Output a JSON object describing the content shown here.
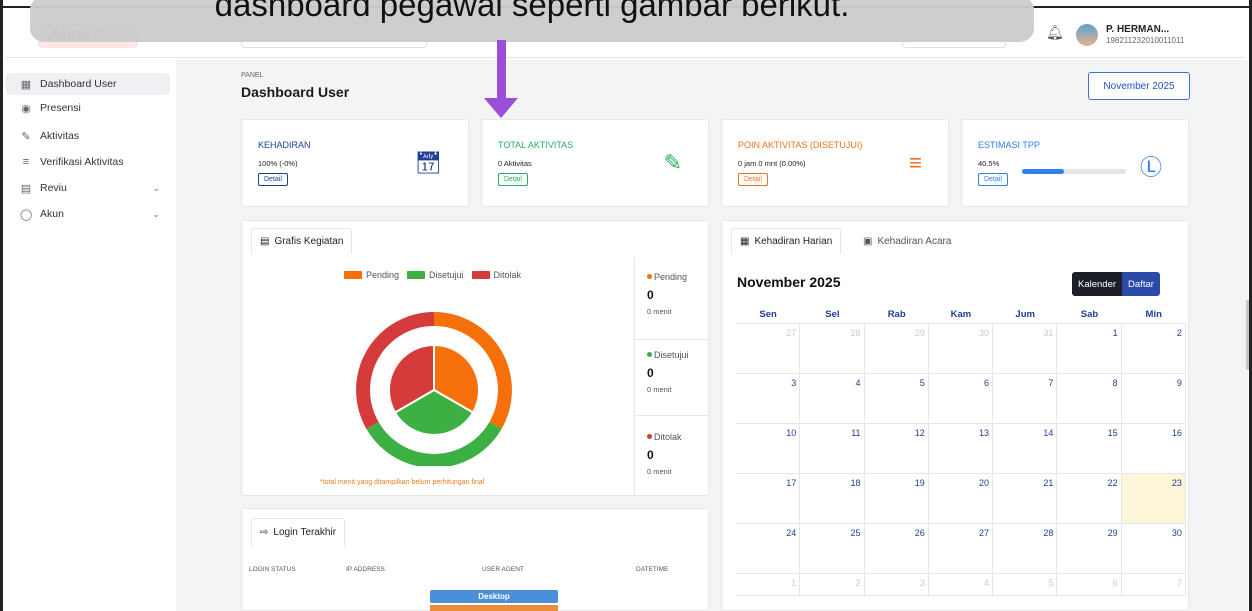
{
  "header": {
    "logo_text": "Ahro ☺",
    "user_name": "P. HERMAN...",
    "user_nip": "198211232010011011"
  },
  "overlay": {
    "caption": "dashboard pegawai seperti gambar berikut."
  },
  "sidebar": {
    "items": [
      {
        "label": "Dashboard User",
        "icon": "grid-icon"
      },
      {
        "label": "Presensi",
        "icon": "fingerprint-icon"
      },
      {
        "label": "Aktivitas",
        "icon": "pen-icon"
      },
      {
        "label": "Verifikasi Aktivitas",
        "icon": "list-check-icon"
      },
      {
        "label": "Reviu",
        "icon": "document-icon"
      },
      {
        "label": "Akun",
        "icon": "user-circle-icon"
      }
    ]
  },
  "page": {
    "panel_label": "PANEL",
    "title": "Dashboard User",
    "month_button": "November 2025"
  },
  "cards": [
    {
      "title": "KEHADIRAN",
      "value": "100% (-0%)",
      "detail": "Detail",
      "color": "#1f3f94",
      "icon": "calendar-icon"
    },
    {
      "title": "TOTAL AKTIVITAS",
      "value": "0 Aktivitas",
      "detail": "Detail",
      "color": "#27ae60",
      "icon": "pencil-icon"
    },
    {
      "title": "POIN AKTIVITAS (DISETUJUI)",
      "value": "0 jam 0 mnt (0.00%)",
      "detail": "Detail",
      "color": "#f2711c",
      "icon": "list-check-icon"
    },
    {
      "title": "ESTIMASI TPP",
      "value": "40.5%",
      "detail": "Detail",
      "color": "#2f80ed",
      "icon": "dollar-circle-icon",
      "progress": 0.405
    }
  ],
  "grafis": {
    "tab_label": "Grafis Kegiatan",
    "legend": [
      {
        "label": "Pending",
        "color": "#f5700a"
      },
      {
        "label": "Disetujui",
        "color": "#3cb043"
      },
      {
        "label": "Ditolak",
        "color": "#d63b3b"
      }
    ],
    "note": "*total menit yang ditampilkan belum perhitungan final",
    "stats": [
      {
        "label": "Pending",
        "count": "0",
        "unit": "0 menit",
        "color": "#f5700a"
      },
      {
        "label": "Disetujui",
        "count": "0",
        "unit": "0 menit",
        "color": "#3cb043"
      },
      {
        "label": "Ditolak",
        "count": "0",
        "unit": "0 menit",
        "color": "#d63b3b"
      }
    ]
  },
  "login": {
    "tab_label": "Login Terakhir",
    "columns": [
      "LOGIN STATUS",
      "IP ADDRESS",
      "USER AGENT",
      "DATETIME"
    ],
    "agent_label": "Desktop"
  },
  "calendar": {
    "tabs": [
      "Kehadiran Harian",
      "Kehadiran Acara"
    ],
    "title": "November 2025",
    "toggle": [
      "Kalender",
      "Daftar"
    ],
    "weekdays": [
      "Sen",
      "Sel",
      "Rab",
      "Kam",
      "Jum",
      "Sab",
      "Min"
    ],
    "weeks": [
      [
        "27",
        "28",
        "29",
        "30",
        "31",
        "1",
        "2"
      ],
      [
        "3",
        "4",
        "5",
        "6",
        "7",
        "8",
        "9"
      ],
      [
        "10",
        "11",
        "12",
        "13",
        "14",
        "15",
        "16"
      ],
      [
        "17",
        "18",
        "19",
        "20",
        "21",
        "22",
        "23"
      ],
      [
        "24",
        "25",
        "26",
        "27",
        "28",
        "29",
        "30"
      ],
      [
        "1",
        "2",
        "3",
        "4",
        "5",
        "6",
        "7"
      ]
    ],
    "today": "23"
  }
}
